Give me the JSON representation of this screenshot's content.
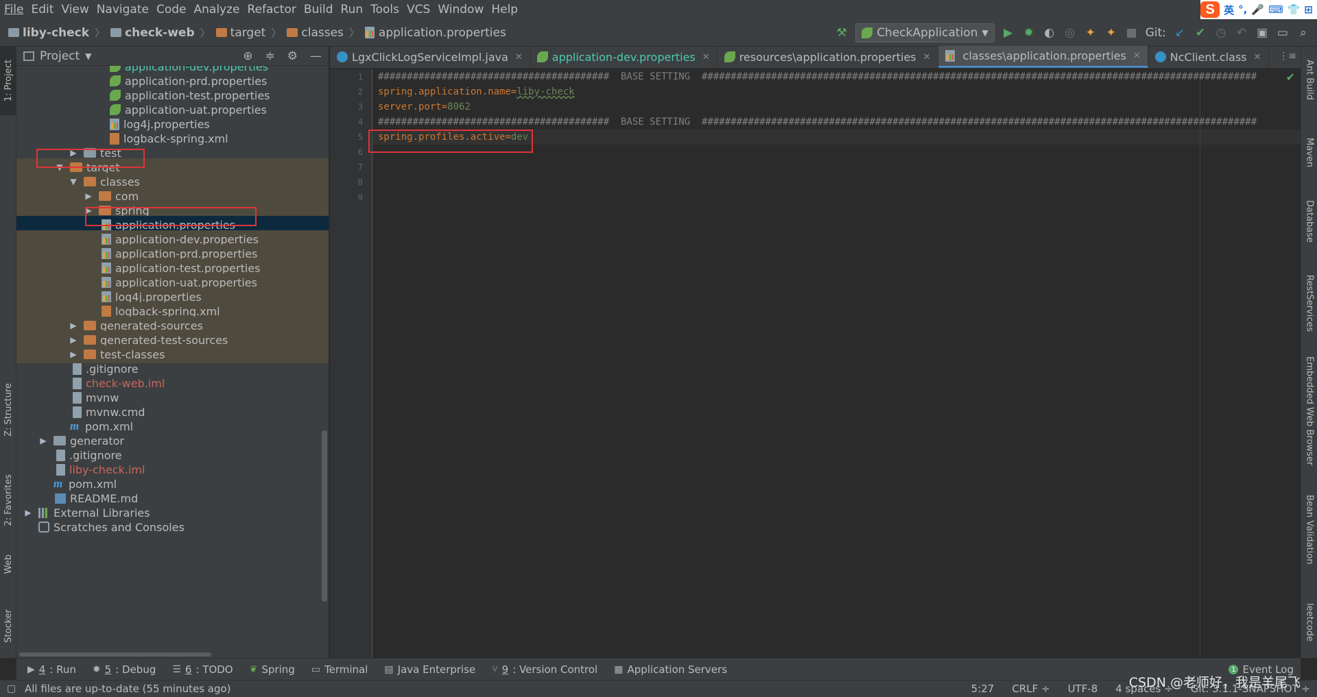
{
  "menu": [
    "File",
    "Edit",
    "View",
    "Navigate",
    "Code",
    "Analyze",
    "Refactor",
    "Build",
    "Run",
    "Tools",
    "VCS",
    "Window",
    "Help"
  ],
  "ime": {
    "logo": "S",
    "lang": "英",
    "items": [
      "°,",
      "🎤",
      "⌨",
      "👕",
      "⊞"
    ]
  },
  "breadcrumb": [
    "liby-check",
    "check-web",
    "target",
    "classes",
    "application.properties"
  ],
  "toolbar": {
    "run_config": "CheckApplication",
    "git_label": "Git:"
  },
  "left_tabs": [
    "1: Project",
    "Z: Structure",
    "2: Favorites",
    "Web",
    "Stocker"
  ],
  "right_tabs": [
    "Ant Build",
    "Maven",
    "Database",
    "RestServices",
    "Embedded Web Browser",
    "Bean Validation",
    "leetcode"
  ],
  "project": {
    "title": "Project",
    "rows": [
      {
        "name": "application-dev.properties",
        "icon": "leafprop",
        "color": "teal"
      },
      {
        "name": "application-prd.properties",
        "icon": "leafprop"
      },
      {
        "name": "application-test.properties",
        "icon": "leafprop"
      },
      {
        "name": "application-uat.properties",
        "icon": "leafprop"
      },
      {
        "name": "log4j.properties",
        "icon": "prop"
      },
      {
        "name": "logback-spring.xml",
        "icon": "xml"
      },
      {
        "name": "test",
        "icon": "fold"
      },
      {
        "name": "target",
        "icon": "fold-orange"
      },
      {
        "name": "classes",
        "icon": "fold-orange"
      },
      {
        "name": "com",
        "icon": "fold-orange"
      },
      {
        "name": "spring",
        "icon": "fold-orange"
      },
      {
        "name": "application.properties",
        "icon": "prop"
      },
      {
        "name": "application-dev.properties",
        "icon": "prop"
      },
      {
        "name": "application-prd.properties",
        "icon": "prop"
      },
      {
        "name": "application-test.properties",
        "icon": "prop"
      },
      {
        "name": "application-uat.properties",
        "icon": "prop"
      },
      {
        "name": "log4j.properties",
        "icon": "prop"
      },
      {
        "name": "logback-spring.xml",
        "icon": "xml"
      },
      {
        "name": "generated-sources",
        "icon": "fold-orange"
      },
      {
        "name": "generated-test-sources",
        "icon": "fold-orange"
      },
      {
        "name": "test-classes",
        "icon": "fold-orange"
      },
      {
        "name": ".gitignore",
        "icon": "plain"
      },
      {
        "name": "check-web.iml",
        "icon": "plain",
        "color": "red"
      },
      {
        "name": "mvnw",
        "icon": "plain"
      },
      {
        "name": "mvnw.cmd",
        "icon": "plain"
      },
      {
        "name": "pom.xml",
        "icon": "m"
      },
      {
        "name": "generator",
        "icon": "fold"
      },
      {
        "name": ".gitignore",
        "icon": "plain"
      },
      {
        "name": "liby-check.iml",
        "icon": "plain",
        "color": "red"
      },
      {
        "name": "pom.xml",
        "icon": "m"
      },
      {
        "name": "README.md",
        "icon": "md"
      },
      {
        "name": "External Libraries",
        "icon": "lib"
      },
      {
        "name": "Scratches and Consoles",
        "icon": "scratch"
      }
    ]
  },
  "tabs": [
    {
      "label": "LgxClickLogServiceImpl.java"
    },
    {
      "label": "application-dev.properties"
    },
    {
      "label": "resources\\application.properties"
    },
    {
      "label": "classes\\application.properties"
    },
    {
      "label": "NcClient.class"
    }
  ],
  "editor": {
    "line_numbers": [
      "1",
      "2",
      "3",
      "4",
      "5",
      "6",
      "7",
      "8",
      "9"
    ],
    "lines": [
      {
        "cmt": "########################################  BASE SETTING  ################################################################################################"
      },
      {
        "key": "spring.application.name",
        "eq": "=",
        "val": "liby-check"
      },
      {
        "key": "server.port",
        "eq": "=",
        "val": "8062"
      },
      {
        "cmt": "########################################  BASE SETTING  ################################################################################################"
      },
      {
        "key": "spring.profiles.active",
        "eq": "=",
        "val": "dev"
      }
    ]
  },
  "bottom_tools": [
    {
      "num": "4",
      "label": ": Run"
    },
    {
      "num": "5",
      "label": ": Debug"
    },
    {
      "num": "6",
      "label": ": TODO"
    },
    {
      "num": "",
      "label": "Spring"
    },
    {
      "num": "",
      "label": "Terminal"
    },
    {
      "num": "",
      "label": "Java Enterprise"
    },
    {
      "num": "9",
      "label": ": Version Control"
    },
    {
      "num": "",
      "label": "Application Servers"
    }
  ],
  "event_log": {
    "count": "1",
    "label": "Event Log"
  },
  "status": {
    "message": "All files are up-to-date (55 minutes ago)",
    "position": "5:27",
    "line_sep": "CRLF ÷",
    "encoding": "UTF-8",
    "indent": "4 spaces ÷",
    "git": "Git: 3.1.1-SNAPSHOT ÷"
  },
  "watermark": "CSDN @老师好，我是羊尾飞"
}
